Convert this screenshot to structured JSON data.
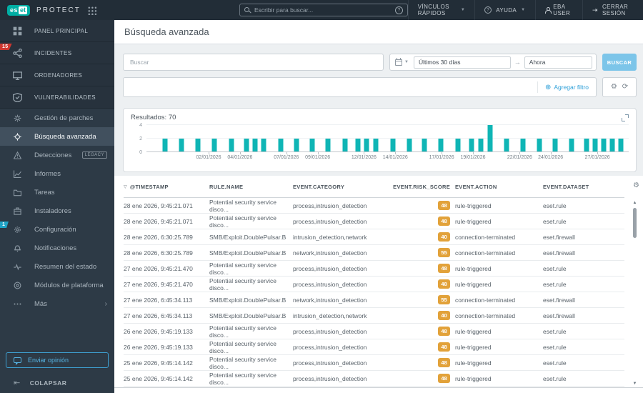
{
  "topbar": {
    "brand": {
      "logo_left": "es",
      "logo_right": "et",
      "product": "PROTECT"
    },
    "search_placeholder": "Escribir para buscar...",
    "menu": [
      {
        "label": "VÍNCULOS RÁPIDOS"
      },
      {
        "label": "AYUDA"
      },
      {
        "label": "EBA USER"
      },
      {
        "label": "CERRAR SESIÓN"
      }
    ]
  },
  "sidebar": {
    "primary": [
      {
        "name": "panel-principal",
        "label": "PANEL PRINCIPAL",
        "icon": "dashboard-icon"
      },
      {
        "name": "incidentes",
        "label": "INCIDENTES",
        "icon": "incidents-icon",
        "badge": "15",
        "badge_color": "red"
      },
      {
        "name": "ordenadores",
        "label": "ORDENADORES",
        "icon": "computers-icon"
      },
      {
        "name": "vulnerabilidades",
        "label": "VULNERABILIDADES",
        "icon": "shield-icon"
      }
    ],
    "secondary": [
      {
        "name": "gestion-de-parches",
        "label": "Gestión de parches",
        "icon": "patch-icon"
      },
      {
        "name": "busqueda-avanzada",
        "label": "Búsqueda avanzada",
        "icon": "advanced-search-icon",
        "active": true
      },
      {
        "name": "detecciones",
        "label": "Detecciones",
        "icon": "detections-icon",
        "tag": "LEGACY"
      },
      {
        "name": "informes",
        "label": "Informes",
        "icon": "reports-icon"
      },
      {
        "name": "tareas",
        "label": "Tareas",
        "icon": "tasks-icon"
      },
      {
        "name": "instaladores",
        "label": "Instaladores",
        "icon": "installers-icon"
      },
      {
        "name": "configuracion",
        "label": "Configuración",
        "icon": "gear-icon",
        "badge": "1",
        "badge_color": "teal"
      },
      {
        "name": "notificaciones",
        "label": "Notificaciones",
        "icon": "bell-icon"
      },
      {
        "name": "resumen-del-estado",
        "label": "Resumen del estado",
        "icon": "status-icon"
      },
      {
        "name": "modulos-de-plataforma",
        "label": "Módulos de plataforma",
        "icon": "modules-icon"
      },
      {
        "name": "mas",
        "label": "Más",
        "icon": "more-icon",
        "chevron": true
      }
    ],
    "feedback_button": "Enviar opinión",
    "collapse": "COLAPSAR"
  },
  "page": {
    "title": "Búsqueda avanzada"
  },
  "search": {
    "placeholder": "Buscar",
    "date_from": "Últimos 30 días",
    "date_to": "Ahora",
    "button": "BUSCAR",
    "add_filter": "Agregar filtro"
  },
  "results": {
    "label": "Resultados:",
    "count": "70"
  },
  "colors": {
    "brand_teal": "#00aea4",
    "bar_teal": "#0fb5b5",
    "risk_amber": "#e2a23a",
    "incident_red": "#cf3730",
    "link_blue": "#2d9fd8",
    "button_blue": "#7cc5e9"
  },
  "chart_data": {
    "type": "bar",
    "title": "Resultados: 70",
    "xlabel": "",
    "ylabel": "",
    "ylim": [
      0,
      4
    ],
    "yticks": [
      0,
      2,
      4
    ],
    "grid": true,
    "bar_color": "#0fb5b5",
    "x_tick_labels": [
      "02/01/2026",
      "04/01/2026",
      "07/01/2026",
      "09/01/2026",
      "12/01/2026",
      "14/01/2026",
      "17/01/2026",
      "19/01/2026",
      "22/01/2026",
      "24/01/2026",
      "27/01/2026"
    ],
    "x_tick_pos": [
      12.9,
      19.4,
      29.0,
      35.5,
      45.1,
      51.6,
      61.2,
      67.7,
      77.4,
      83.8,
      93.5
    ],
    "bars": [
      {
        "date": "30/12/2025",
        "v": 2,
        "pos": 3.8
      },
      {
        "date": "31/12/2025",
        "v": 2,
        "pos": 7.3
      },
      {
        "date": "01/01/2026",
        "v": 2,
        "pos": 10.7
      },
      {
        "date": "02/01/2026",
        "v": 2,
        "pos": 14.0
      },
      {
        "date": "03/01/2026",
        "v": 2,
        "pos": 17.7
      },
      {
        "date": "04/01/2026",
        "v": 2,
        "pos": 20.7
      },
      {
        "date": "05/01/2026",
        "v": 2,
        "pos": 22.5
      },
      {
        "date": "05/01/2026",
        "v": 2,
        "pos": 24.3
      },
      {
        "date": "06/01/2026",
        "v": 2,
        "pos": 27.8
      },
      {
        "date": "07/01/2026",
        "v": 2,
        "pos": 31.1
      },
      {
        "date": "08/01/2026",
        "v": 2,
        "pos": 34.4
      },
      {
        "date": "09/01/2026",
        "v": 2,
        "pos": 37.7
      },
      {
        "date": "10/01/2026",
        "v": 2,
        "pos": 41.2
      },
      {
        "date": "11/01/2026",
        "v": 2,
        "pos": 43.9
      },
      {
        "date": "12/01/2026",
        "v": 2,
        "pos": 45.7
      },
      {
        "date": "12/01/2026",
        "v": 2,
        "pos": 47.6
      },
      {
        "date": "13/01/2026",
        "v": 2,
        "pos": 51.1
      },
      {
        "date": "14/01/2026",
        "v": 2,
        "pos": 54.5
      },
      {
        "date": "15/01/2026",
        "v": 2,
        "pos": 57.7
      },
      {
        "date": "16/01/2026",
        "v": 2,
        "pos": 61.0
      },
      {
        "date": "18/01/2026",
        "v": 2,
        "pos": 64.6
      },
      {
        "date": "18/01/2026",
        "v": 2,
        "pos": 67.4
      },
      {
        "date": "19/01/2026",
        "v": 2,
        "pos": 69.3
      },
      {
        "date": "20/01/2026",
        "v": 4,
        "pos": 71.3
      },
      {
        "date": "21/01/2026",
        "v": 2,
        "pos": 74.6
      },
      {
        "date": "22/01/2026",
        "v": 2,
        "pos": 78.0
      },
      {
        "date": "23/01/2026",
        "v": 2,
        "pos": 81.5
      },
      {
        "date": "24/01/2026",
        "v": 2,
        "pos": 84.8
      },
      {
        "date": "25/01/2026",
        "v": 2,
        "pos": 88.1
      },
      {
        "date": "26/01/2026",
        "v": 2,
        "pos": 91.2
      },
      {
        "date": "26/01/2026",
        "v": 2,
        "pos": 93.0
      },
      {
        "date": "27/01/2026",
        "v": 2,
        "pos": 94.8
      },
      {
        "date": "27/01/2026",
        "v": 2,
        "pos": 96.6
      },
      {
        "date": "28/01/2026",
        "v": 2,
        "pos": 98.3
      }
    ]
  },
  "table": {
    "columns": [
      {
        "key": "timestamp",
        "label": "@TIMESTAMP",
        "sorted": true
      },
      {
        "key": "rule",
        "label": "RULE.NAME"
      },
      {
        "key": "category",
        "label": "EVENT.CATEGORY"
      },
      {
        "key": "risk",
        "label": "EVENT.RISK_SCORE"
      },
      {
        "key": "action",
        "label": "EVENT.ACTION"
      },
      {
        "key": "dataset",
        "label": "EVENT.DATASET"
      }
    ],
    "rows": [
      {
        "timestamp": "28 ene 2026, 9:45:21.071",
        "rule": "Potential security service disco...",
        "category": "process,intrusion_detection",
        "risk": "48",
        "action": "rule-triggered",
        "dataset": "eset.rule"
      },
      {
        "timestamp": "28 ene 2026, 9:45:21.071",
        "rule": "Potential security service disco...",
        "category": "process,intrusion_detection",
        "risk": "48",
        "action": "rule-triggered",
        "dataset": "eset.rule"
      },
      {
        "timestamp": "28 ene 2026, 6:30:25.789",
        "rule": "SMB/Exploit.DoublePulsar.B",
        "category": "intrusion_detection,network",
        "risk": "40",
        "action": "connection-terminated",
        "dataset": "eset.firewall"
      },
      {
        "timestamp": "28 ene 2026, 6:30:25.789",
        "rule": "SMB/Exploit.DoublePulsar.B",
        "category": "network,intrusion_detection",
        "risk": "55",
        "action": "connection-terminated",
        "dataset": "eset.firewall"
      },
      {
        "timestamp": "27 ene 2026, 9:45:21.470",
        "rule": "Potential security service disco...",
        "category": "process,intrusion_detection",
        "risk": "48",
        "action": "rule-triggered",
        "dataset": "eset.rule"
      },
      {
        "timestamp": "27 ene 2026, 9:45:21.470",
        "rule": "Potential security service disco...",
        "category": "process,intrusion_detection",
        "risk": "48",
        "action": "rule-triggered",
        "dataset": "eset.rule"
      },
      {
        "timestamp": "27 ene 2026, 6:45:34.113",
        "rule": "SMB/Exploit.DoublePulsar.B",
        "category": "network,intrusion_detection",
        "risk": "55",
        "action": "connection-terminated",
        "dataset": "eset.firewall"
      },
      {
        "timestamp": "27 ene 2026, 6:45:34.113",
        "rule": "SMB/Exploit.DoublePulsar.B",
        "category": "intrusion_detection,network",
        "risk": "40",
        "action": "connection-terminated",
        "dataset": "eset.firewall"
      },
      {
        "timestamp": "26 ene 2026, 9:45:19.133",
        "rule": "Potential security service disco...",
        "category": "process,intrusion_detection",
        "risk": "48",
        "action": "rule-triggered",
        "dataset": "eset.rule"
      },
      {
        "timestamp": "26 ene 2026, 9:45:19.133",
        "rule": "Potential security service disco...",
        "category": "process,intrusion_detection",
        "risk": "48",
        "action": "rule-triggered",
        "dataset": "eset.rule"
      },
      {
        "timestamp": "25 ene 2026, 9:45:14.142",
        "rule": "Potential security service disco...",
        "category": "process,intrusion_detection",
        "risk": "48",
        "action": "rule-triggered",
        "dataset": "eset.rule"
      },
      {
        "timestamp": "25 ene 2026, 9:45:14.142",
        "rule": "Potential security service disco...",
        "category": "process,intrusion_detection",
        "risk": "48",
        "action": "rule-triggered",
        "dataset": "eset.rule"
      }
    ]
  }
}
